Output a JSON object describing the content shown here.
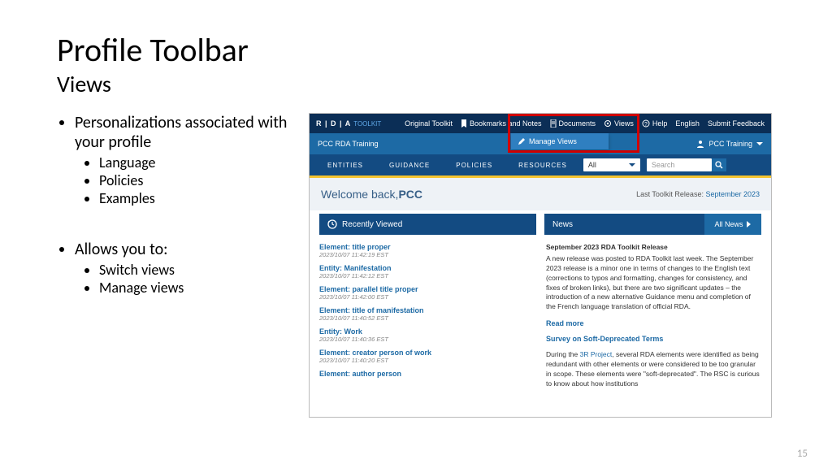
{
  "slide": {
    "title": "Profile Toolbar",
    "subtitle": "Views",
    "page_number": "15",
    "bullets": {
      "group1": {
        "main": "Personalizations associated with your profile",
        "sub": [
          "Language",
          "Policies",
          "Examples"
        ]
      },
      "group2": {
        "main": "Allows you to:",
        "sub": [
          "Switch views",
          "Manage views"
        ]
      }
    }
  },
  "app": {
    "logo": {
      "rda": "R | D | A",
      "toolkit": "TOOLKIT"
    },
    "toplinks": {
      "original": "Original Toolkit",
      "bookmarks": "Bookmarks and Notes",
      "documents": "Documents",
      "views": "Views",
      "help": "Help",
      "language": "English",
      "feedback": "Submit Feedback"
    },
    "bar2": {
      "training": "PCC RDA Training",
      "manage_views": "Manage Views",
      "user": "PCC Training"
    },
    "nav": {
      "entities": "ENTITIES",
      "guidance": "GUIDANCE",
      "policies": "POLICIES",
      "resources": "RESOURCES",
      "all": "All",
      "search_placeholder": "Search"
    },
    "welcome": {
      "prefix": "Welcome back, ",
      "name": "PCC",
      "release_label": "Last Toolkit Release: ",
      "release_value": "September 2023"
    },
    "panels": {
      "recent": {
        "title": "Recently Viewed",
        "items": [
          {
            "t": "Element: title proper",
            "d": "2023/10/07 11:42:19 EST"
          },
          {
            "t": "Entity: Manifestation",
            "d": "2023/10/07 11:42:12 EST"
          },
          {
            "t": "Element: parallel title proper",
            "d": "2023/10/07 11:42:00 EST"
          },
          {
            "t": "Element: title of manifestation",
            "d": "2023/10/07 11:40:52 EST"
          },
          {
            "t": "Entity: Work",
            "d": "2023/10/07 11:40:36 EST"
          },
          {
            "t": "Element: creator person of work",
            "d": "2023/10/07 11:40:20 EST"
          },
          {
            "t": "Element: author person",
            "d": ""
          }
        ]
      },
      "news": {
        "title": "News",
        "allnews": "All News",
        "headline": "September 2023 RDA Toolkit Release",
        "body": "A new release was posted to RDA Toolkit last week. The September 2023 release is a minor one in terms of changes to the English text (corrections to typos and formatting, changes for consistency, and fixes of broken links), but there are two significant updates – the introduction of a new alternative Guidance menu and completion of the French language translation of official RDA.",
        "readmore": "Read more",
        "survey": "Survey on Soft-Deprecated Terms",
        "body2a": "During the ",
        "body2link": "3R Project",
        "body2b": ", several RDA elements were identified as being redundant with other elements or were considered to be too granular in scope. These elements were \"soft-deprecated\". The RSC is curious to know about how institutions"
      }
    }
  }
}
